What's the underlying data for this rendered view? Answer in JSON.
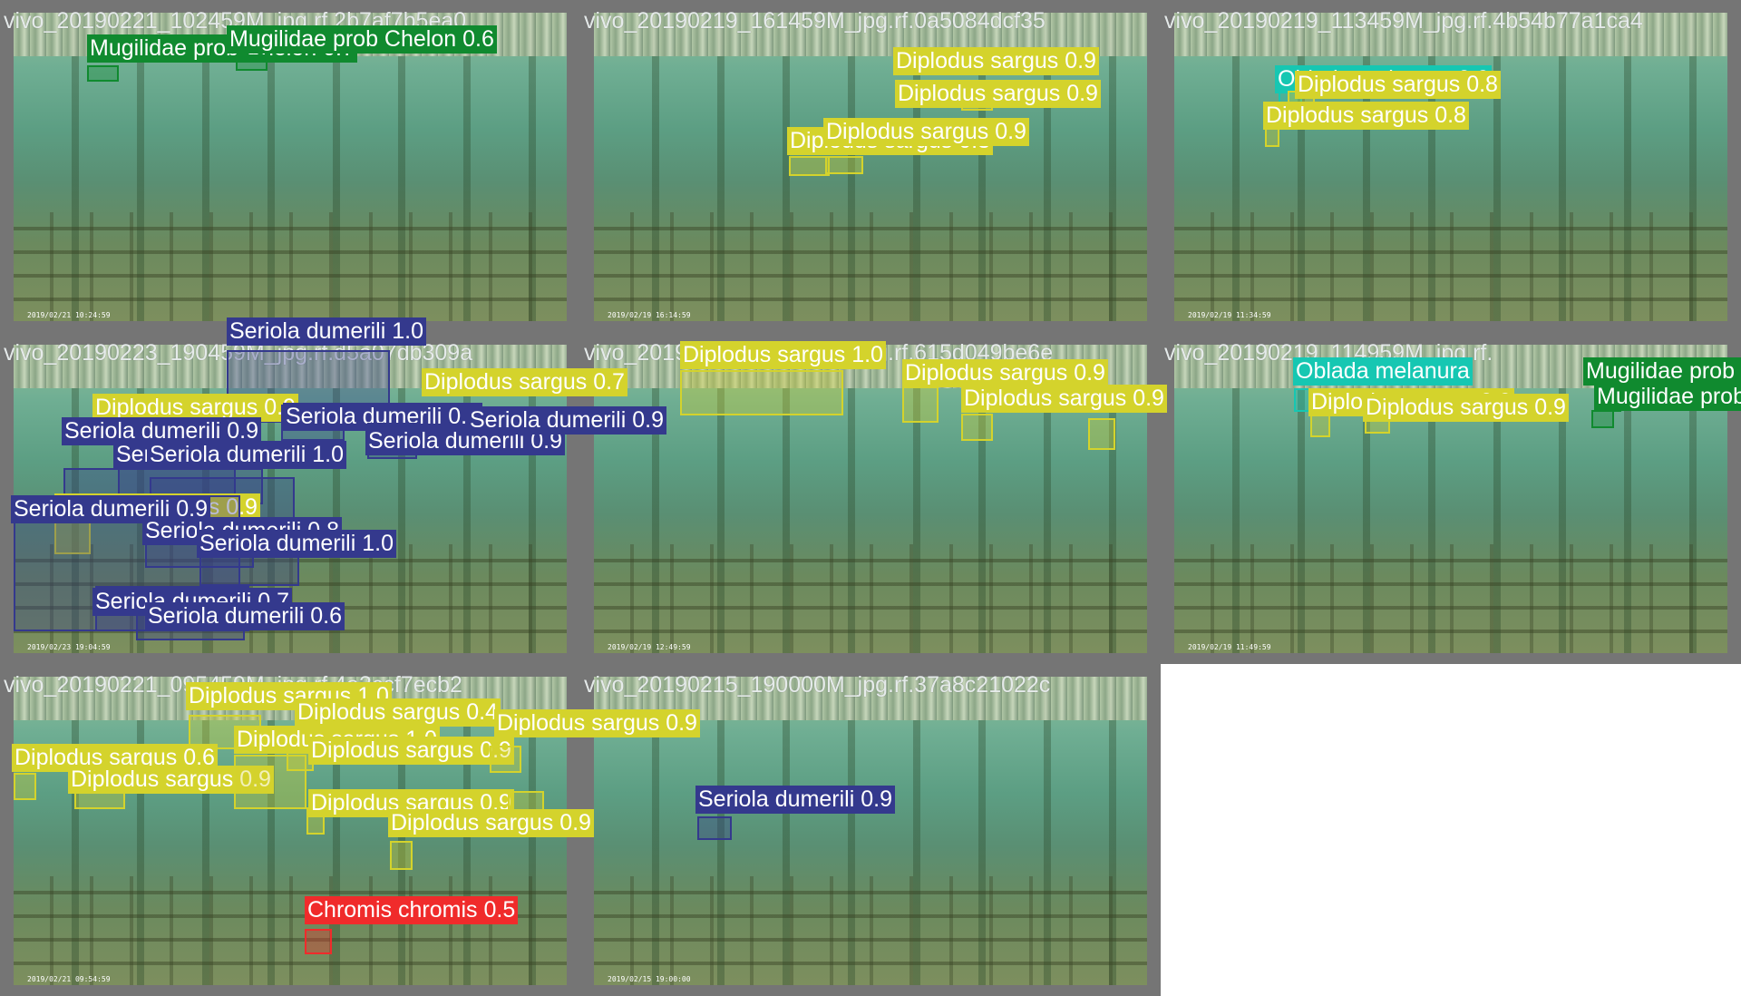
{
  "colors": {
    "diplodus_sargus": "#d4d32c",
    "seriola_dumerili": "#34398d",
    "mugilidae": "#108a2f",
    "oblada": "#16c7b2",
    "chromis": "#f02b2b"
  },
  "tiles": [
    {
      "title": "vivo_20190221_102459M_jpg.rf.2b7af7b5ea0",
      "timestamp": "2019/02/21 10:24:59",
      "detections": [
        {
          "label": "Mugilidae prob Chelon 0.7",
          "class": "mugilidae"
        },
        {
          "label": "Mugilidae prob Chelon 0.6",
          "class": "mugilidae"
        }
      ]
    },
    {
      "title": "vivo_20190219_161459M_jpg.rf.0a5084dcf35",
      "timestamp": "2019/02/19 16:14:59",
      "detections": [
        {
          "label": "Diplodus sargus 0.3",
          "class": "diplodus_sargus"
        },
        {
          "label": "Diplodus sargus 0.9",
          "class": "diplodus_sargus"
        },
        {
          "label": "Diplodus sargus 0.9",
          "class": "diplodus_sargus"
        },
        {
          "label": "Diplodus sargus 0.9",
          "class": "diplodus_sargus"
        }
      ]
    },
    {
      "title": "vivo_20190219_113459M_jpg.rf.4b54b77a1ca4",
      "timestamp": "2019/02/19 11:34:59",
      "detections": [
        {
          "label": "Oblada melanura 0.9",
          "class": "oblada"
        },
        {
          "label": "Diplodus sargus 0.8",
          "class": "diplodus_sargus"
        },
        {
          "label": "Diplodus sargus 0.8",
          "class": "diplodus_sargus"
        }
      ]
    },
    {
      "title": "vivo_20190223_190459M_jpg.rf.d5a07db309a",
      "timestamp": "2019/02/23 19:04:59",
      "detections": [
        {
          "label": "Seriola dumerili 1.0",
          "class": "seriola_dumerili"
        },
        {
          "label": "Diplodus sargus 0.9",
          "class": "diplodus_sargus"
        },
        {
          "label": "Seriola dumerili 0.9",
          "class": "seriola_dumerili"
        },
        {
          "label": "Seriola dumerili 0.9",
          "class": "seriola_dumerili"
        },
        {
          "label": "Seriola dumerili 1.0",
          "class": "seriola_dumerili"
        },
        {
          "label": "Seriola dumerili 1.0",
          "class": "seriola_dumerili"
        },
        {
          "label": "Seriola dumerili 0.9",
          "class": "seriola_dumerili"
        },
        {
          "label": "Seriola dumerili 0.9",
          "class": "seriola_dumerili"
        },
        {
          "label": "Diplodus sargus 0.9",
          "class": "diplodus_sargus"
        },
        {
          "label": "Seriola dumerili 0.9",
          "class": "seriola_dumerili"
        },
        {
          "label": "Seriola dumerili 0.8",
          "class": "seriola_dumerili"
        },
        {
          "label": "Seriola dumerili 1.0",
          "class": "seriola_dumerili"
        },
        {
          "label": "Seriola dumerili 0.7",
          "class": "seriola_dumerili"
        },
        {
          "label": "Seriola dumerili 0.6",
          "class": "seriola_dumerili"
        }
      ]
    },
    {
      "title": "vivo_20190219_124959M_jpg.rf.615d049be6e",
      "timestamp": "2019/02/19 12:49:59",
      "detections": [
        {
          "label": "Diplodus sargus 1.0",
          "class": "diplodus_sargus"
        },
        {
          "label": "Diplodus sargus 0.7",
          "class": "diplodus_sargus"
        },
        {
          "label": "Diplodus sargus 0.9",
          "class": "diplodus_sargus"
        },
        {
          "label": "Diplodus sargus 0.9",
          "class": "diplodus_sargus"
        }
      ]
    },
    {
      "title": "vivo_20190219_114959M_jpg.rf.",
      "timestamp": "2019/02/19 11:49:59",
      "detections": [
        {
          "label": "Oblada melanura",
          "class": "oblada"
        },
        {
          "label": "Mugilidae prob Chelon",
          "class": "mugilidae"
        },
        {
          "label": "Mugilidae prob",
          "class": "mugilidae"
        },
        {
          "label": "Diplodus sargus 0.9",
          "class": "diplodus_sargus"
        },
        {
          "label": "Diplodus sargus 0.9",
          "class": "diplodus_sargus"
        }
      ]
    },
    {
      "title": "vivo_20190221_095459M_jpg.rf.4a3ccf7ecb2",
      "timestamp": "2019/02/21 09:54:59",
      "detections": [
        {
          "label": "Diplodus sargus 1.0",
          "class": "diplodus_sargus"
        },
        {
          "label": "Diplodus sargus 0.4",
          "class": "diplodus_sargus"
        },
        {
          "label": "Diplodus sargus 0.6",
          "class": "diplodus_sargus"
        },
        {
          "label": "Diplodus sargus 0.9",
          "class": "diplodus_sargus"
        },
        {
          "label": "Diplodus sargus 1.0",
          "class": "diplodus_sargus"
        },
        {
          "label": "Diplodus sargus 0.9",
          "class": "diplodus_sargus"
        },
        {
          "label": "Diplodus sargus 0.9",
          "class": "diplodus_sargus"
        },
        {
          "label": "Diplodus sargus 0.9",
          "class": "diplodus_sargus"
        },
        {
          "label": "Diplodus sargus 0.9",
          "class": "diplodus_sargus"
        },
        {
          "label": "Chromis chromis 0.5",
          "class": "chromis"
        }
      ]
    },
    {
      "title": "vivo_20190215_190000M_jpg.rf.37a8c21022c",
      "timestamp": "2019/02/15 19:00:00",
      "detections": [
        {
          "label": "Seriola dumerili 0.9",
          "class": "seriola_dumerili"
        }
      ]
    }
  ]
}
